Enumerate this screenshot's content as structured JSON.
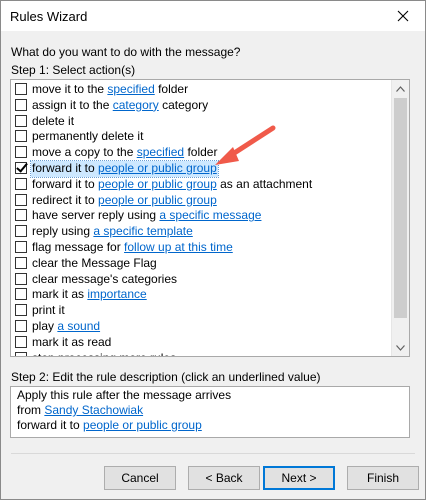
{
  "window": {
    "title": "Rules Wizard"
  },
  "question": "What do you want to do with the message?",
  "step1_label": "Step 1: Select action(s)",
  "actions": [
    {
      "checked": false,
      "parts": [
        "move it to the ",
        "specified",
        " folder"
      ]
    },
    {
      "checked": false,
      "parts": [
        "assign it to the ",
        "category",
        " category"
      ]
    },
    {
      "checked": false,
      "parts": [
        "delete it"
      ]
    },
    {
      "checked": false,
      "parts": [
        "permanently delete it"
      ]
    },
    {
      "checked": false,
      "parts": [
        "move a copy to the ",
        "specified",
        " folder"
      ]
    },
    {
      "checked": true,
      "selected": true,
      "parts": [
        "forward it to ",
        "people or public group"
      ]
    },
    {
      "checked": false,
      "parts": [
        "forward it to ",
        "people or public group",
        " as an attachment"
      ]
    },
    {
      "checked": false,
      "parts": [
        "redirect it to ",
        "people or public group"
      ]
    },
    {
      "checked": false,
      "parts": [
        "have server reply using ",
        "a specific message"
      ]
    },
    {
      "checked": false,
      "parts": [
        "reply using ",
        "a specific template"
      ]
    },
    {
      "checked": false,
      "parts": [
        "flag message for ",
        "follow up at this time"
      ]
    },
    {
      "checked": false,
      "parts": [
        "clear the Message Flag"
      ]
    },
    {
      "checked": false,
      "parts": [
        "clear message's categories"
      ]
    },
    {
      "checked": false,
      "parts": [
        "mark it as ",
        "importance"
      ]
    },
    {
      "checked": false,
      "parts": [
        "print it"
      ]
    },
    {
      "checked": false,
      "parts": [
        "play ",
        "a sound"
      ]
    },
    {
      "checked": false,
      "parts": [
        "mark it as read"
      ]
    },
    {
      "checked": false,
      "parts": [
        "stop processing more rules"
      ]
    }
  ],
  "step2_label": "Step 2: Edit the rule description (click an underlined value)",
  "description": {
    "line1": "Apply this rule after the message arrives",
    "line2_prefix": "from ",
    "line2_link": "Sandy Stachowiak",
    "line3_prefix": "forward it to ",
    "line3_link": "people or public group"
  },
  "buttons": {
    "cancel": "Cancel",
    "back": "< Back",
    "next": "Next >",
    "finish": "Finish"
  },
  "colors": {
    "link": "#0066cc",
    "annotation_arrow": "#f05a4a",
    "selection": "#cde8ff",
    "default_button_border": "#0078d7"
  },
  "icons": {
    "close": "close-icon",
    "scroll_up": "chevron-up-icon",
    "scroll_down": "chevron-down-icon",
    "checkmark": "checkmark-icon",
    "annotation": "arrow-icon"
  }
}
